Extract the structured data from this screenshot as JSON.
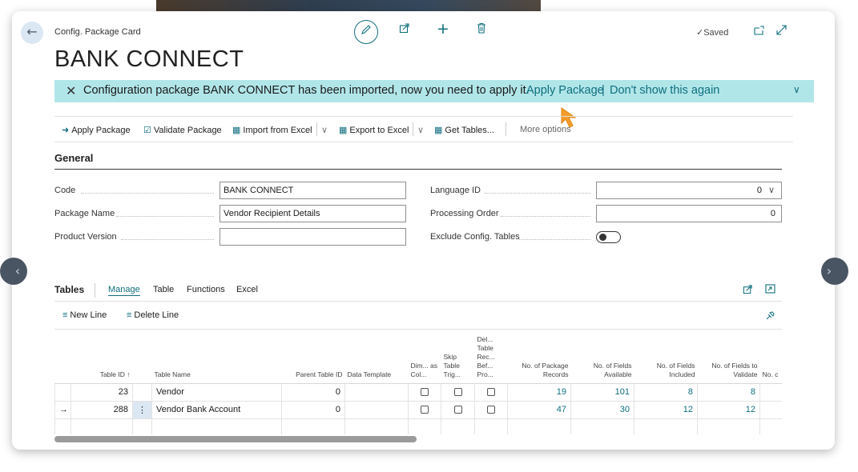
{
  "breadcrumb": "Config. Package Card",
  "title": "BANK CONNECT",
  "save_status": "Saved",
  "toolbar_icons": [
    "edit-icon",
    "share-icon",
    "add-icon",
    "delete-icon"
  ],
  "window_icons": [
    "open-new-window-icon",
    "expand-icon"
  ],
  "banner": {
    "message": "Configuration package BANK CONNECT has been imported, now you need to apply it.",
    "apply_link": "Apply Package",
    "separator": "|",
    "dismiss_link": "Don't show this again"
  },
  "actions": {
    "apply_package": "Apply Package",
    "validate_package": "Validate Package",
    "import_from_excel": "Import from Excel",
    "export_to_excel": "Export to Excel",
    "get_tables": "Get Tables...",
    "more_options": "More options"
  },
  "general": {
    "heading": "General",
    "code_label": "Code",
    "code_value": "BANK CONNECT",
    "package_name_label": "Package Name",
    "package_name_value": "Vendor Recipient Details",
    "product_version_label": "Product Version",
    "product_version_value": "",
    "language_id_label": "Language ID",
    "language_id_value": "0",
    "processing_order_label": "Processing Order",
    "processing_order_value": "0",
    "exclude_config_label": "Exclude Config. Tables",
    "exclude_config_value": false
  },
  "tables_part": {
    "heading": "Tables",
    "tabs": [
      "Manage",
      "Table",
      "Functions",
      "Excel"
    ],
    "active_tab": "Manage",
    "new_line": "New Line",
    "delete_line": "Delete Line",
    "columns": {
      "table_id": "Table ID ↑",
      "table_name": "Table Name",
      "parent_table_id": "Parent Table ID",
      "data_template": "Data Template",
      "dim_as_col": "Dim... as Col...",
      "skip_table_trig": "Skip Table Trig...",
      "del_table_rec": "Del... Table Rec... Bef... Pro...",
      "no_of_package_records": "No. of Package Records",
      "no_of_fields_available": "No. of Fields Available",
      "no_of_fields_included": "No. of Fields Included",
      "no_of_fields_to_validate": "No. of Fields to Validate",
      "no_of_more": "No. c"
    },
    "rows": [
      {
        "current": "",
        "table_id": "23",
        "table_name": "Vendor",
        "parent_table_id": "0",
        "data_template": "",
        "package_records": "19",
        "fields_available": "101",
        "fields_included": "8",
        "fields_to_validate": "8"
      },
      {
        "current": "→",
        "table_id": "288",
        "table_name": "Vendor Bank Account",
        "parent_table_id": "0",
        "data_template": "",
        "package_records": "47",
        "fields_available": "30",
        "fields_included": "12",
        "fields_to_validate": "12"
      }
    ]
  }
}
